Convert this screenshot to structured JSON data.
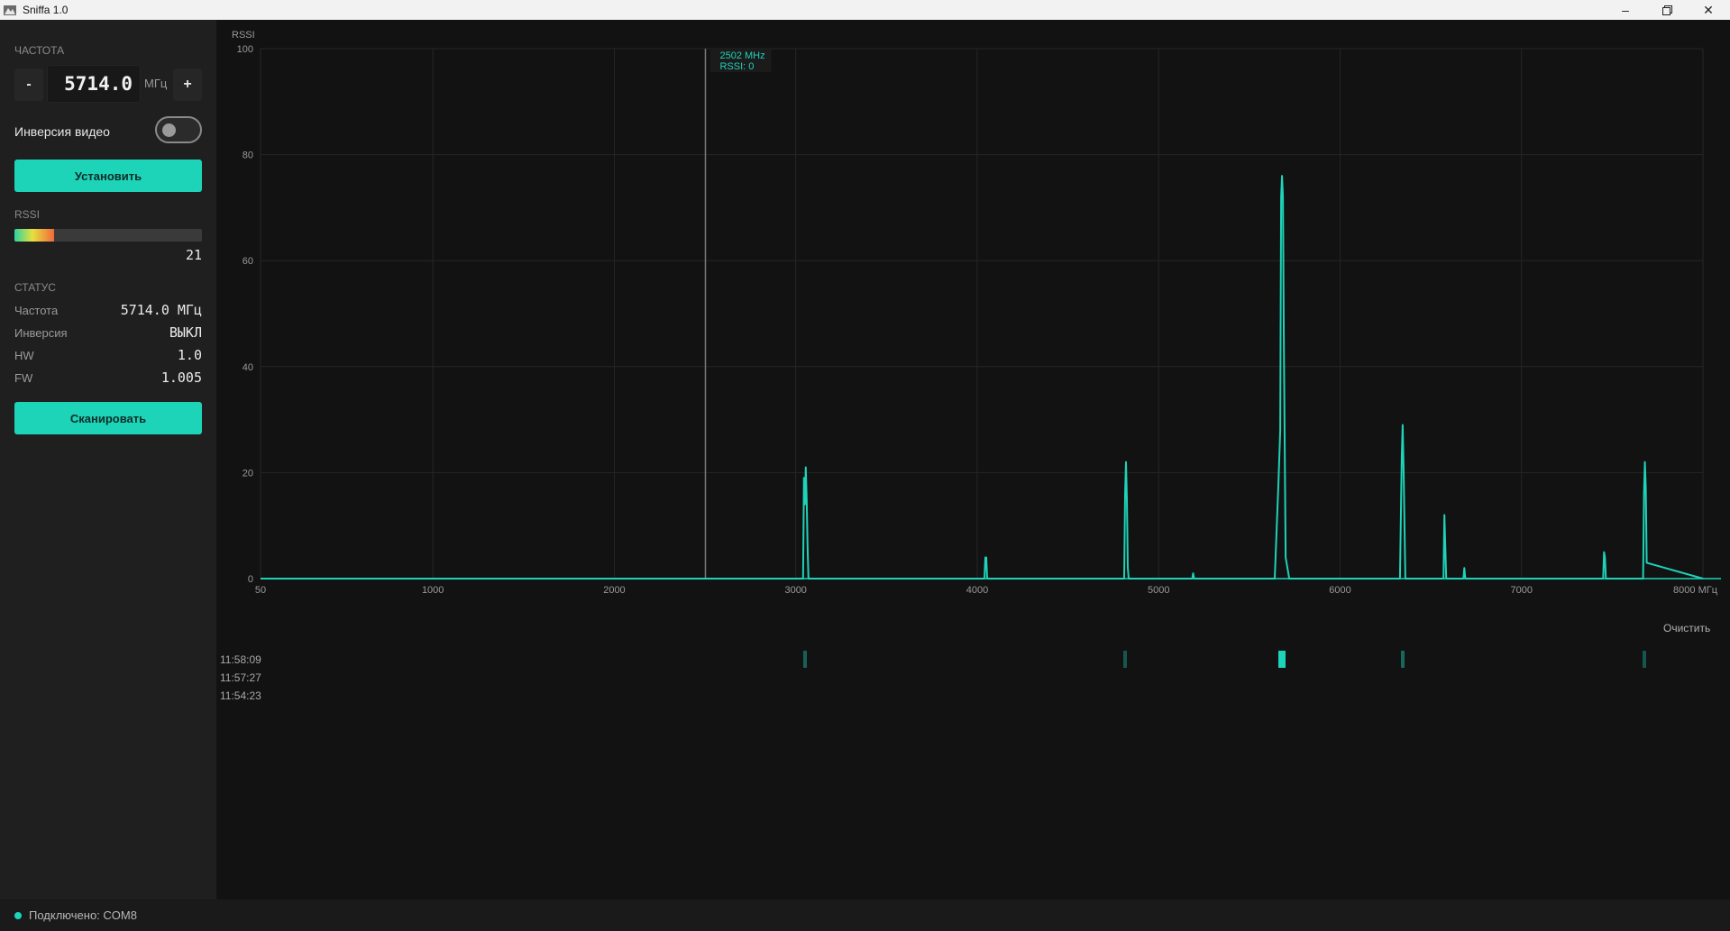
{
  "window": {
    "title": "Sniffa 1.0",
    "minimize_icon": "minimize-icon",
    "maximize_icon": "restore-icon",
    "close_icon": "close-icon"
  },
  "sidebar": {
    "frequency_label": "ЧАСТОТА",
    "minus_label": "-",
    "plus_label": "+",
    "frequency_value": "5714.0",
    "frequency_unit": "МГц",
    "inversion_label": "Инверсия видео",
    "inversion_on": false,
    "set_button": "Установить",
    "rssi_label": "RSSI",
    "rssi_value": "21",
    "rssi_level_percent": 21,
    "status_label": "СТАТУС",
    "status": [
      {
        "key": "Частота",
        "value": "5714.0 МГц"
      },
      {
        "key": "Инверсия",
        "value": "ВЫКЛ"
      },
      {
        "key": "HW",
        "value": "1.0"
      },
      {
        "key": "FW",
        "value": "1.005"
      }
    ],
    "scan_button": "Сканировать"
  },
  "statusbar": {
    "connection": "Подключено: COM8",
    "dot_color": "#1dd3b8"
  },
  "accent_color": "#1dd3b8",
  "cursor": {
    "freq_text": "2502 MHz",
    "rssi_text": "RSSI: 0",
    "x": 2502
  },
  "chart_data": {
    "type": "line",
    "ylabel": "RSSI",
    "ylim": [
      0,
      100
    ],
    "xlim": [
      50,
      8000
    ],
    "y_ticks": [
      0,
      20,
      40,
      60,
      80,
      100
    ],
    "x_ticks": [
      {
        "v": 50,
        "label": "50"
      },
      {
        "v": 1000,
        "label": "1000"
      },
      {
        "v": 2000,
        "label": "2000"
      },
      {
        "v": 3000,
        "label": "3000"
      },
      {
        "v": 4000,
        "label": "4000"
      },
      {
        "v": 5000,
        "label": "5000"
      },
      {
        "v": 6000,
        "label": "6000"
      },
      {
        "v": 7000,
        "label": "7000"
      },
      {
        "v": 8000,
        "label": "8000 МГц"
      }
    ],
    "grid": true,
    "series": [
      {
        "color": "#1dd3b8",
        "x": [
          50,
          3040,
          3045,
          3050,
          3055,
          3060,
          3065,
          3070,
          4040,
          4045,
          4050,
          4055,
          4060,
          4810,
          4815,
          4820,
          4825,
          4830,
          4835,
          5185,
          5190,
          5195,
          5640,
          5660,
          5670,
          5675,
          5680,
          5685,
          5690,
          5700,
          5720,
          6330,
          6340,
          6345,
          6350,
          6360,
          6570,
          6575,
          6580,
          6585,
          6680,
          6685,
          6690,
          7450,
          7455,
          7460,
          7465,
          7670,
          7675,
          7680,
          7685,
          7690,
          8000
        ],
        "y": [
          0,
          0,
          19,
          14,
          21,
          15,
          6,
          0,
          0,
          4,
          4,
          0,
          0,
          0,
          16,
          22,
          15,
          2,
          0,
          0,
          1,
          0,
          0,
          18,
          28,
          72,
          76,
          72,
          45,
          4,
          0,
          0,
          23,
          29,
          21,
          0,
          0,
          12,
          6,
          0,
          0,
          2,
          0,
          0,
          5,
          4,
          0,
          0,
          16,
          22,
          17,
          3,
          0
        ]
      }
    ]
  },
  "history": {
    "clear_label": "Очистить",
    "times": [
      "11:58:09",
      "11:57:27",
      "11:54:23"
    ],
    "waterfall_marks": [
      {
        "x": 3050,
        "level": 0.3
      },
      {
        "x": 4815,
        "level": 0.25
      },
      {
        "x": 5680,
        "level": 1.0
      },
      {
        "x": 6345,
        "level": 0.35
      },
      {
        "x": 7675,
        "level": 0.25
      }
    ]
  }
}
